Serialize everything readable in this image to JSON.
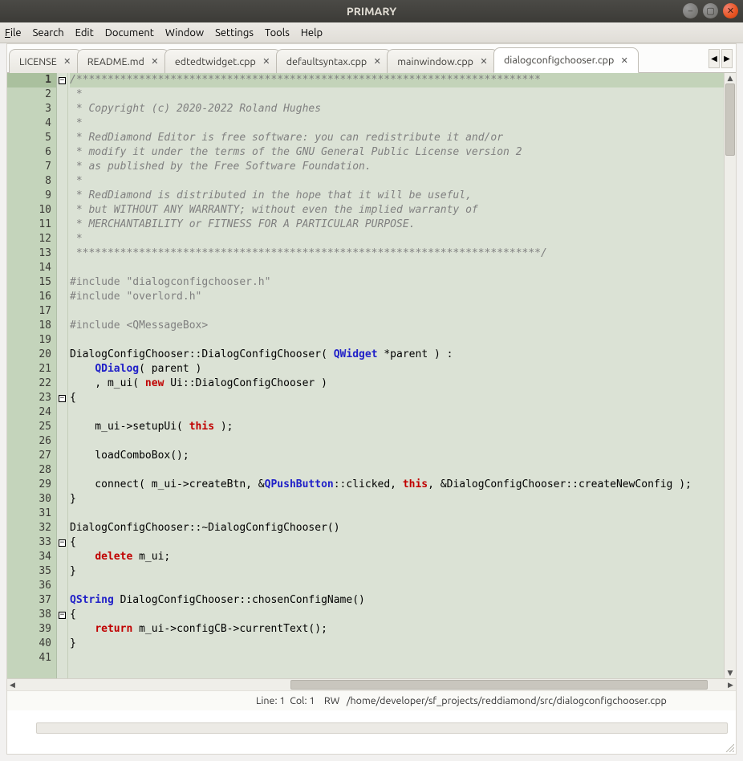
{
  "window": {
    "title": "PRIMARY"
  },
  "win_buttons": {
    "min": "minimize-icon",
    "max": "maximize-icon",
    "close": "close-icon"
  },
  "menubar": {
    "items": [
      "File",
      "Search",
      "Edit",
      "Document",
      "Window",
      "Settings",
      "Tools",
      "Help"
    ]
  },
  "tabs": {
    "scroll_left": "◀",
    "scroll_right": "▶",
    "items": [
      {
        "label": "LICENSE",
        "active": false
      },
      {
        "label": "README.md",
        "active": false
      },
      {
        "label": "edtedtwidget.cpp",
        "active": false
      },
      {
        "label": "defaultsyntax.cpp",
        "active": false
      },
      {
        "label": "mainwindow.cpp",
        "active": false
      },
      {
        "label": "dialogconfigchooser.cpp",
        "active": true
      }
    ]
  },
  "editor": {
    "first_line_no": 1,
    "current_line": 1,
    "fold_markers": {
      "1": "-",
      "23": "-",
      "33": "-",
      "38": "-"
    },
    "lines": [
      {
        "t": "comment",
        "s": "/**************************************************************************"
      },
      {
        "t": "comment",
        "s": " *"
      },
      {
        "t": "comment",
        "s": " * Copyright (c) 2020-2022 Roland Hughes"
      },
      {
        "t": "comment",
        "s": " *"
      },
      {
        "t": "comment",
        "s": " * RedDiamond Editor is free software: you can redistribute it and/or"
      },
      {
        "t": "comment",
        "s": " * modify it under the terms of the GNU General Public License version 2"
      },
      {
        "t": "comment",
        "s": " * as published by the Free Software Foundation."
      },
      {
        "t": "comment",
        "s": " *"
      },
      {
        "t": "comment",
        "s": " * RedDiamond is distributed in the hope that it will be useful,"
      },
      {
        "t": "comment",
        "s": " * but WITHOUT ANY WARRANTY; without even the implied warranty of"
      },
      {
        "t": "comment",
        "s": " * MERCHANTABILITY or FITNESS FOR A PARTICULAR PURPOSE."
      },
      {
        "t": "comment",
        "s": " *"
      },
      {
        "t": "comment",
        "s": " **************************************************************************/"
      },
      {
        "t": "plain",
        "s": ""
      },
      {
        "t": "prep",
        "s": "#include \"dialogconfigchooser.h\""
      },
      {
        "t": "prep",
        "s": "#include \"overlord.h\""
      },
      {
        "t": "plain",
        "s": ""
      },
      {
        "t": "prep",
        "s": "#include <QMessageBox>"
      },
      {
        "t": "plain",
        "s": ""
      },
      {
        "t": "mixed",
        "h": "DialogConfigChooser::DialogConfigChooser( <type>QWidget</type> *parent ) :"
      },
      {
        "t": "mixed",
        "h": "    <type>QDialog</type>( parent )"
      },
      {
        "t": "mixed",
        "h": "    , m_ui( <kw2>new</kw2> Ui::DialogConfigChooser )"
      },
      {
        "t": "plain",
        "s": "{"
      },
      {
        "t": "plain",
        "s": ""
      },
      {
        "t": "mixed",
        "h": "    m_ui->setupUi( <kw2>this</kw2> );"
      },
      {
        "t": "plain",
        "s": ""
      },
      {
        "t": "plain",
        "s": "    loadComboBox();"
      },
      {
        "t": "plain",
        "s": ""
      },
      {
        "t": "mixed",
        "h": "    connect( m_ui->createBtn, &<type>QPushButton</type>::clicked, <kw2>this</kw2>, &DialogConfigChooser::createNewConfig );"
      },
      {
        "t": "plain",
        "s": "}"
      },
      {
        "t": "plain",
        "s": ""
      },
      {
        "t": "plain",
        "s": "DialogConfigChooser::~DialogConfigChooser()"
      },
      {
        "t": "plain",
        "s": "{"
      },
      {
        "t": "mixed",
        "h": "    <kw2>delete</kw2> m_ui;"
      },
      {
        "t": "plain",
        "s": "}"
      },
      {
        "t": "plain",
        "s": ""
      },
      {
        "t": "mixed",
        "h": "<type>QString</type> DialogConfigChooser::chosenConfigName()"
      },
      {
        "t": "plain",
        "s": "{"
      },
      {
        "t": "mixed",
        "h": "    <kw2>return</kw2> m_ui->configCB->currentText();"
      },
      {
        "t": "plain",
        "s": "}"
      },
      {
        "t": "plain",
        "s": ""
      }
    ]
  },
  "status": {
    "line_label": "Line:",
    "line_value": "1",
    "col_label": "Col:",
    "col_value": "1",
    "mode": "RW",
    "path": "/home/developer/sf_projects/reddiamond/src/dialogconfigchooser.cpp"
  }
}
